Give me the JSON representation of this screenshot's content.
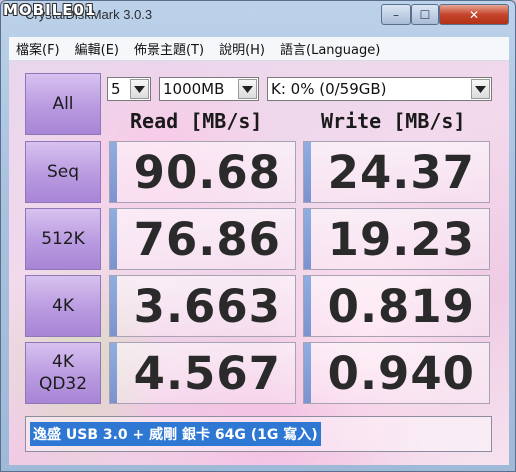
{
  "watermark": "MOBILE01",
  "window": {
    "title": "CrystalDiskMark 3.0.3",
    "buttons": {
      "minimize": "–",
      "maximize": "☐",
      "close": "✕"
    }
  },
  "menu": [
    "檔案(F)",
    "編輯(E)",
    "佈景主題(T)",
    "說明(H)",
    "語言(Language)"
  ],
  "controls": {
    "all_label": "All",
    "count": "5",
    "size": "1000MB",
    "drive": "K: 0% (0/59GB)"
  },
  "headers": {
    "read": "Read [MB/s]",
    "write": "Write [MB/s]"
  },
  "rows": [
    {
      "label": "Seq",
      "label2": "",
      "read": "90.68",
      "write": "24.37"
    },
    {
      "label": "512K",
      "label2": "",
      "read": "76.86",
      "write": "19.23"
    },
    {
      "label": "4K",
      "label2": "",
      "read": "3.663",
      "write": "0.819"
    },
    {
      "label": "4K",
      "label2": "QD32",
      "read": "4.567",
      "write": "0.940"
    }
  ],
  "comment": "逸盛 USB 3.0 + 威剛 銀卡 64G (1G 寫入)",
  "colors": {
    "accent": "#2e78d4",
    "button": "#b99ae0"
  }
}
